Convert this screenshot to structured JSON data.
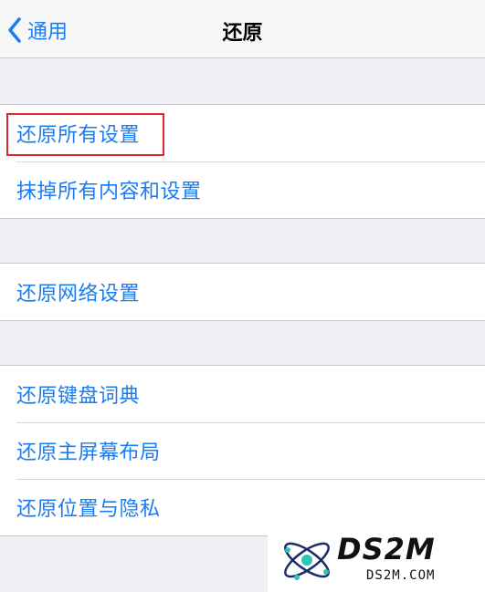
{
  "nav": {
    "back_label": "通用",
    "title": "还原"
  },
  "groups": [
    {
      "items": [
        "还原所有设置",
        "抹掉所有内容和设置"
      ]
    },
    {
      "items": [
        "还原网络设置"
      ]
    },
    {
      "items": [
        "还原键盘词典",
        "还原主屏幕布局",
        "还原位置与隐私"
      ]
    }
  ],
  "highlight": {
    "target": "还原所有设置",
    "color": "#e3262b"
  },
  "watermark": {
    "text": "DS2M",
    "sub": "DS2M.COM"
  },
  "colors": {
    "accent": "#1a7cf2",
    "background": "#efeff4"
  }
}
